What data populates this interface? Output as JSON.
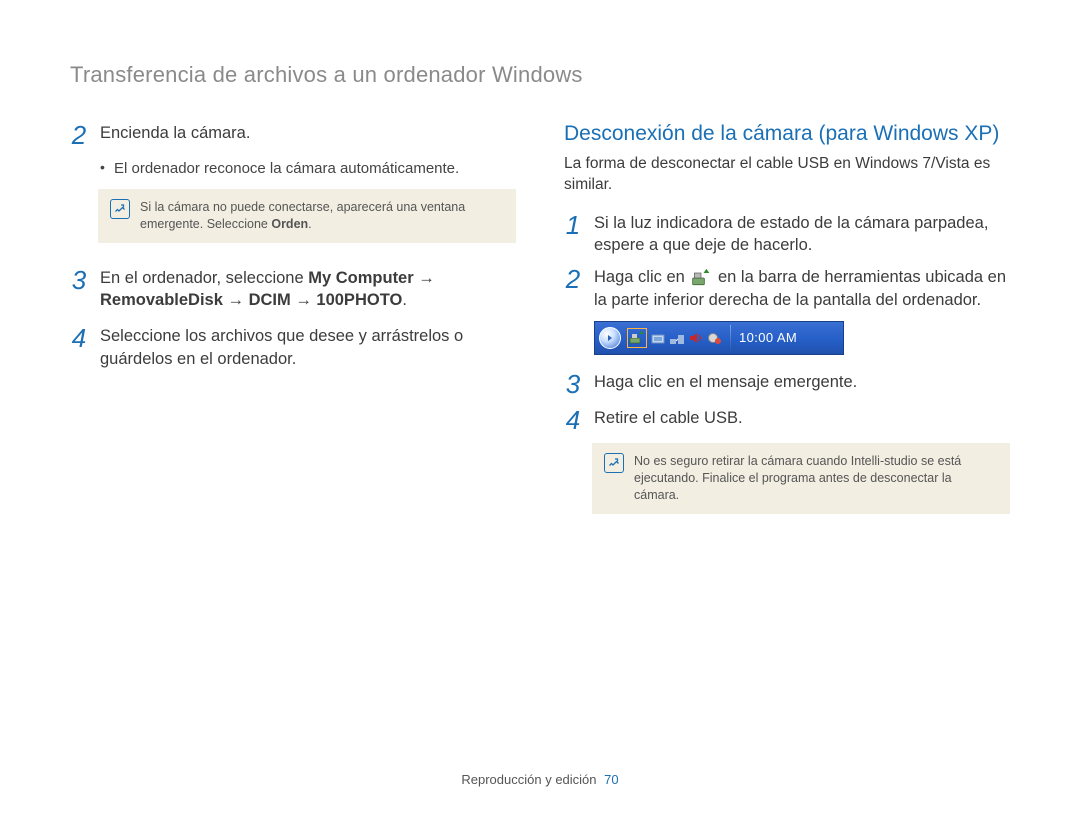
{
  "header": {
    "title": "Transferencia de archivos a un ordenador Windows"
  },
  "left": {
    "step2_num": "2",
    "step2_text": "Encienda la cámara.",
    "step2_bullet": "El ordenador reconoce la cámara automáticamente.",
    "note1_a": "Si la cámara no puede conectarse, aparecerá una ventana emergente. Seleccione ",
    "note1_bold": "Orden",
    "note1_b": ".",
    "step3_num": "3",
    "step3_a": "En el ordenador, seleccione ",
    "step3_b1": "My Computer",
    "step3_arrow1": " → ",
    "step3_b2": "RemovableDisk",
    "step3_arrow2": " → ",
    "step3_b3": "DCIM",
    "step3_arrow3": " → ",
    "step3_b4": "100PHOTO",
    "step3_c": ".",
    "step4_num": "4",
    "step4_text": "Seleccione los archivos que desee y arrástrelos o guárdelos en el ordenador."
  },
  "right": {
    "section_title": "Desconexión de la cámara (para Windows XP)",
    "intro": "La forma de desconectar el cable USB en Windows 7/Vista es similar.",
    "step1_num": "1",
    "step1_text": "Si la luz indicadora de estado de la cámara parpadea, espere a que deje de hacerlo.",
    "step2_num": "2",
    "step2_a": "Haga clic en ",
    "step2_b": " en la barra de herramientas ubicada en la parte inferior derecha de la pantalla del ordenador.",
    "taskbar_clock": "10:00 AM",
    "step3_num": "3",
    "step3_text": "Haga clic en el mensaje emergente.",
    "step4_num": "4",
    "step4_text": "Retire el cable USB.",
    "note2": "No es seguro retirar la cámara cuando Intelli-studio se está ejecutando. Finalice el programa antes de desconectar la cámara."
  },
  "footer": {
    "section": "Reproducción y edición",
    "page": "70"
  },
  "icons": {
    "note_icon": "note-icon",
    "safely_remove_icon": "safely-remove-hardware-icon"
  }
}
